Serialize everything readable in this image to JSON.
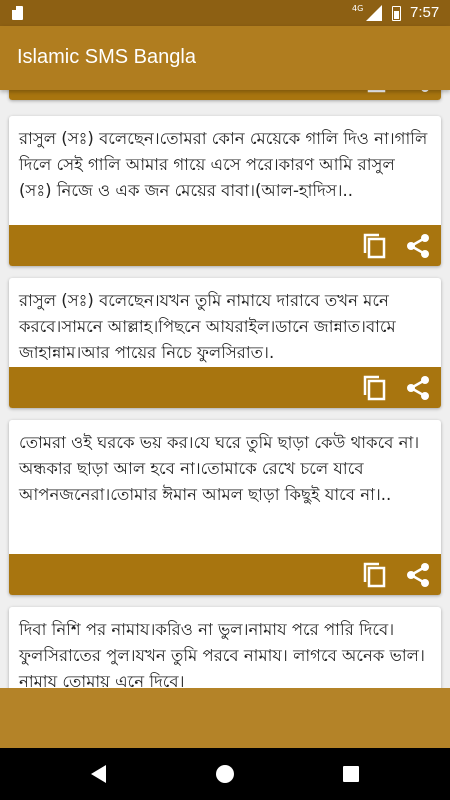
{
  "status_bar": {
    "network": "4G",
    "time": "7:57"
  },
  "app_bar": {
    "title": "Islamic SMS Bangla"
  },
  "cards": [
    {
      "text": ""
    },
    {
      "text": "রাসুল (সঃ) বলেছেন।তোমরা কোন মেয়েকে গালি দিও না।গালি দিলে সেই গালি আমার গায়ে এসে পরে।কারণ আমি রাসুল (সঃ) নিজে ও এক জন মেয়ের বাবা।(আল-হাদিস।.."
    },
    {
      "text": "রাসুল (সঃ) বলেছেন।যখন তুমি নামাযে দারাবে তখন মনে করবে।সামনে আল্লাহ।পিছনে আযরাইল।ডানে জান্নাত।বামে জাহান্নাম।আর পায়ের নিচে ফুলসিরাত।."
    },
    {
      "text": "তোমরা ওই ঘরকে ভয় কর।যে ঘরে তুমি ছাড়া কেউ থাকবে না।অন্ধকার ছাড়া আল হবে না।তোমাকে রেখে চলে যাবে আপনজনেরা।তোমার ঈমান আমল ছাড়া কিছুই যাবে না।.."
    },
    {
      "text": "দিবা নিশি পর নামায।করিও না ভুল।নামায পরে পারি দিবে।ফুলসিরাতের পুল।যখন তুমি পরবে নামায। লাগবে অনেক ভাল।নামায তোমায় এনে দিবে।"
    }
  ],
  "icons": {
    "copy": "copy-icon",
    "share": "share-icon",
    "back": "back-icon",
    "home": "home-icon",
    "recents": "recents-icon"
  },
  "colors": {
    "status_bar": "#8d6013",
    "app_bar": "#b07d1f",
    "card_action_bar": "#a8750f",
    "background": "#efefef"
  }
}
